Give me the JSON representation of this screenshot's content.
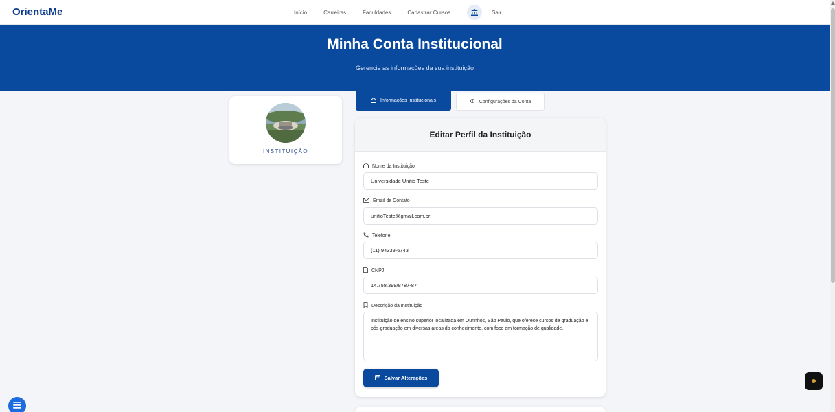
{
  "brand": "OrientaMe",
  "nav": {
    "items": [
      "Início",
      "Carreiras",
      "Faculdades",
      "Cadastrar Cursos"
    ],
    "logout": "Sair"
  },
  "hero": {
    "title": "Minha Conta Institucional",
    "subtitle": "Gerencie as informações da sua instituição"
  },
  "profile": {
    "label": "INSTITUIÇÃO"
  },
  "tabs": [
    {
      "label": "Informações Institucionais",
      "icon": "home-icon",
      "active": true
    },
    {
      "label": "Configurações da Conta",
      "icon": "gear-icon",
      "active": false
    }
  ],
  "form": {
    "title": "Editar Perfil da Instituição",
    "fields": {
      "name": {
        "label": "Nome da Instituição",
        "value": "Universidade Unifio Teste"
      },
      "email": {
        "label": "Email de Contato",
        "value": "unifioTeste@gmail.com.br"
      },
      "phone": {
        "label": "Telefone",
        "value": "(11) 94339-6743"
      },
      "cnpj": {
        "label": "CNPJ",
        "value": "14.758.399/8787-87"
      },
      "description": {
        "label": "Descrição da Instituição",
        "value": "Instituição de ensino superior localizada em Ourinhos, São Paulo, que oferece cursos de graduação e pós-graduação em diversas áreas do conhecimento, com foco em formação de qualidade."
      }
    },
    "save_label": "Salvar Alterações"
  },
  "colors": {
    "primary": "#0a4a9e",
    "background": "#f3f5f8",
    "fab": "#1e6be0"
  }
}
